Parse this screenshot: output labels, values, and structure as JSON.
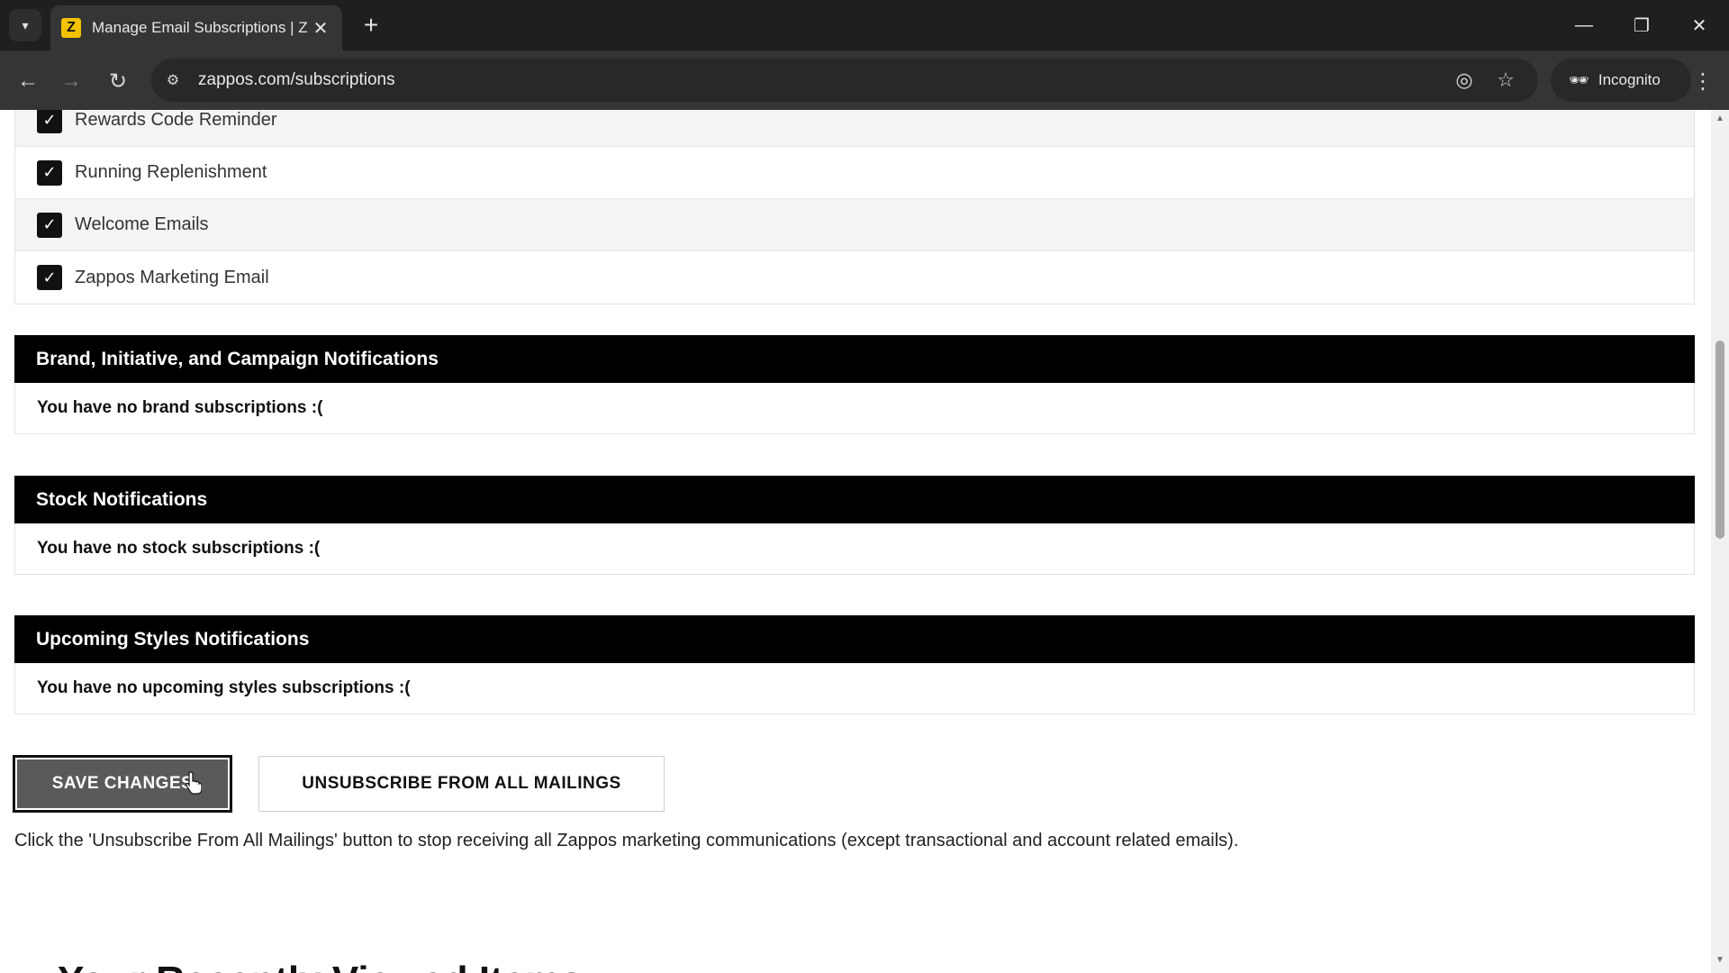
{
  "browser": {
    "tab_title": "Manage Email Subscriptions | Z",
    "favicon_letter": "Z",
    "url": "zappos.com/subscriptions",
    "incognito_label": "Incognito",
    "accent_color": "#f2c200"
  },
  "subscriptions": [
    {
      "label": "Rewards Code Reminder",
      "checked": true
    },
    {
      "label": "Running Replenishment",
      "checked": true
    },
    {
      "label": "Welcome Emails",
      "checked": true
    },
    {
      "label": "Zappos Marketing Email",
      "checked": true
    }
  ],
  "sections": {
    "brand": {
      "title": "Brand, Initiative, and Campaign Notifications",
      "empty_text": "You have no brand subscriptions :("
    },
    "stock": {
      "title": "Stock Notifications",
      "empty_text": "You have no stock subscriptions :("
    },
    "upcoming": {
      "title": "Upcoming Styles Notifications",
      "empty_text": "You have no upcoming styles subscriptions :("
    }
  },
  "actions": {
    "save_label": "SAVE CHANGES",
    "unsubscribe_label": "UNSUBSCRIBE FROM ALL MAILINGS",
    "note": "Click the 'Unsubscribe From All Mailings' button to stop receiving all Zappos marketing communications (except transactional and account related emails)."
  },
  "next_heading": "Your Recently Viewed Items"
}
